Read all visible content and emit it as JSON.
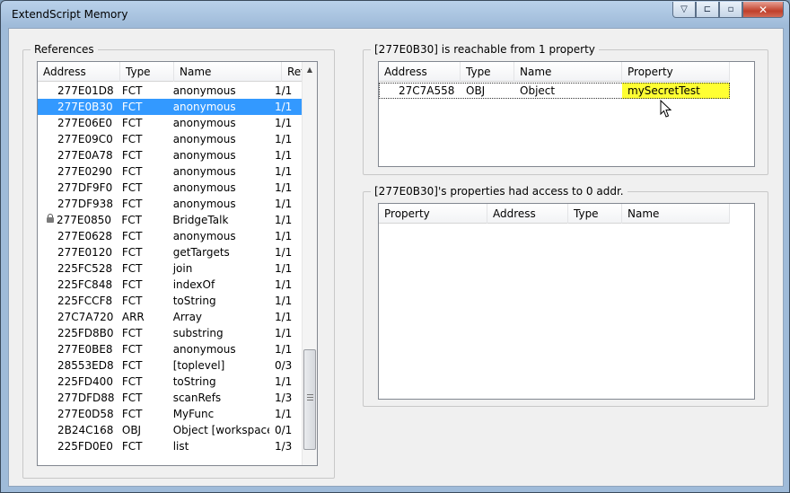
{
  "window": {
    "title": "ExtendScript Memory",
    "buttons": {
      "minimize_glyph": "▽",
      "restore_glyph": "⊏",
      "maximize_glyph": "▫",
      "close_glyph": "✕"
    }
  },
  "references": {
    "label": "References",
    "columns": [
      "Address",
      "Type",
      "Name",
      "Refs"
    ],
    "rows": [
      {
        "address": "277E01D8",
        "type": "FCT",
        "name": "anonymous",
        "refs": "1/1"
      },
      {
        "address": "277E0B30",
        "type": "FCT",
        "name": "anonymous",
        "refs": "1/1",
        "selected": true
      },
      {
        "address": "277E06E0",
        "type": "FCT",
        "name": "anonymous",
        "refs": "1/1"
      },
      {
        "address": "277E09C0",
        "type": "FCT",
        "name": "anonymous",
        "refs": "1/1"
      },
      {
        "address": "277E0A78",
        "type": "FCT",
        "name": "anonymous",
        "refs": "1/1"
      },
      {
        "address": "277E0290",
        "type": "FCT",
        "name": "anonymous",
        "refs": "1/1"
      },
      {
        "address": "277DF9F0",
        "type": "FCT",
        "name": "anonymous",
        "refs": "1/1"
      },
      {
        "address": "277DF938",
        "type": "FCT",
        "name": "anonymous",
        "refs": "1/1"
      },
      {
        "address": "277E0850",
        "type": "FCT",
        "name": "BridgeTalk",
        "refs": "1/1",
        "locked": true
      },
      {
        "address": "277E0628",
        "type": "FCT",
        "name": "anonymous",
        "refs": "1/1"
      },
      {
        "address": "277E0120",
        "type": "FCT",
        "name": "getTargets",
        "refs": "1/1"
      },
      {
        "address": "225FC528",
        "type": "FCT",
        "name": "join",
        "refs": "1/1"
      },
      {
        "address": "225FC848",
        "type": "FCT",
        "name": "indexOf",
        "refs": "1/1"
      },
      {
        "address": "225FCCF8",
        "type": "FCT",
        "name": "toString",
        "refs": "1/1"
      },
      {
        "address": "27C7A720",
        "type": "ARR",
        "name": "Array",
        "refs": "1/1"
      },
      {
        "address": "225FD8B0",
        "type": "FCT",
        "name": "substring",
        "refs": "1/1"
      },
      {
        "address": "277E0BE8",
        "type": "FCT",
        "name": "anonymous",
        "refs": "1/1"
      },
      {
        "address": "28553ED8",
        "type": "FCT",
        "name": "[toplevel]",
        "refs": "0/3"
      },
      {
        "address": "225FD400",
        "type": "FCT",
        "name": "toString",
        "refs": "1/1"
      },
      {
        "address": "277DFD88",
        "type": "FCT",
        "name": "scanRefs",
        "refs": "1/3"
      },
      {
        "address": "277E0D58",
        "type": "FCT",
        "name": "MyFunc",
        "refs": "1/1"
      },
      {
        "address": "2B24C168",
        "type": "OBJ",
        "name": "Object [workspace]",
        "refs": "0/1"
      },
      {
        "address": "225FD0E0",
        "type": "FCT",
        "name": "list",
        "refs": "1/3"
      }
    ]
  },
  "reachable": {
    "label": "[277E0B30] is reachable from 1 property",
    "columns": [
      "Address",
      "Type",
      "Name",
      "Property"
    ],
    "rows": [
      {
        "address": "27C7A558",
        "type": "OBJ",
        "name": "Object",
        "property": "mySecretTest"
      }
    ]
  },
  "properties": {
    "label": "[277E0B30]'s properties had access to 0 addr.",
    "columns": [
      "Property",
      "Address",
      "Type",
      "Name"
    ],
    "rows": []
  },
  "colors": {
    "selection": "#3399ff",
    "highlight": "#ffff33"
  }
}
